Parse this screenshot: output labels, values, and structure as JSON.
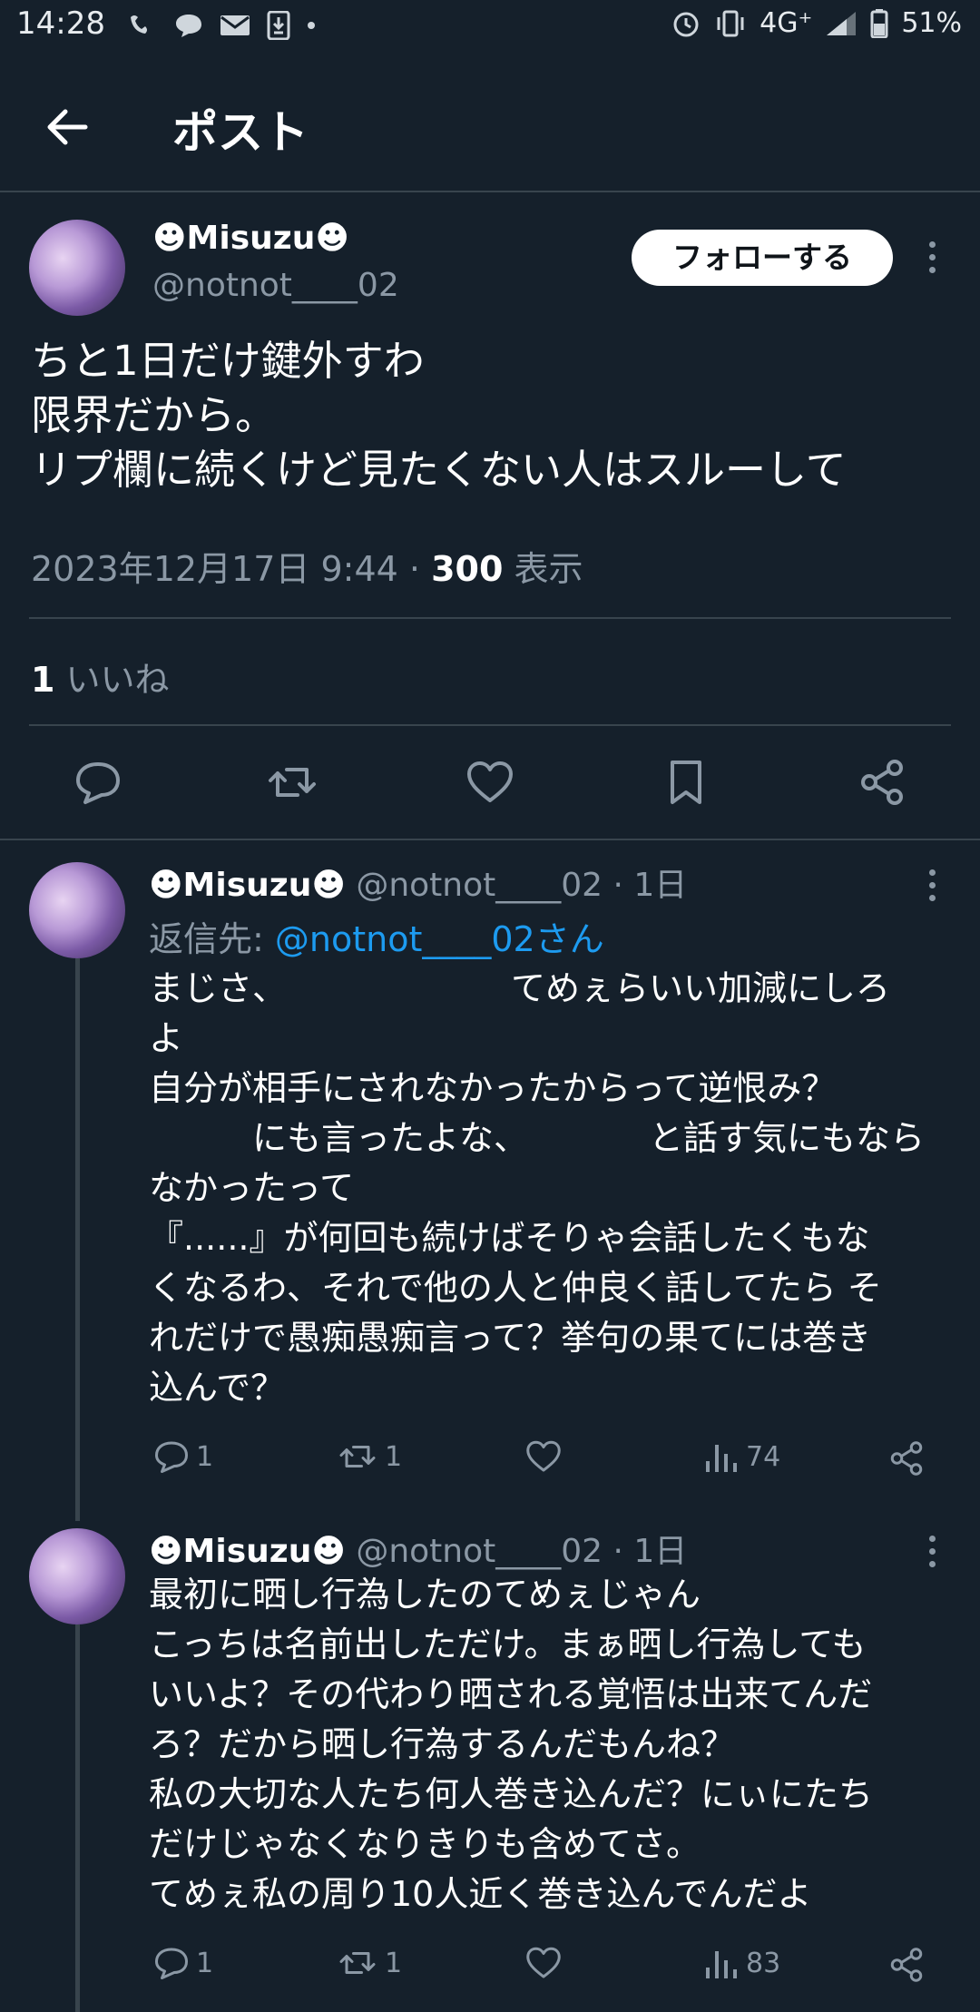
{
  "status_bar": {
    "time": "14:28",
    "network": "4G⁺",
    "battery": "51%"
  },
  "header": {
    "title": "ポスト"
  },
  "main_post": {
    "display_name": "☻Misuzu☻",
    "handle": "@notnot____02",
    "follow_label": "フォローする",
    "lines": [
      "ちと1日だけ鍵外すわ",
      "限界だから。",
      "リプ欄に続くけど見たくない人はスルーして"
    ],
    "timestamp": "2023年12月17日 9:44 · ",
    "views_count": "300",
    "views_label": " 表示",
    "likes_count": "1",
    "likes_label": " いいね"
  },
  "replies": [
    {
      "display_name": "☻Misuzu☻",
      "handle": " @notnot____02 · 1日",
      "reply_to_prefix": "返信先: ",
      "reply_to_handle": "@notnot____02さん",
      "lines": [
        "まじさ、　　　　　　　てめぇらいい加減にしろ",
        "よ",
        "自分が相手にされなかったからって逆恨み？",
        "　　　にも言ったよな、　　　　と話す気にもなら",
        "なかったって",
        "『......』が何回も続けばそりゃ会話したくもな",
        "くなるわ、それで他の人と仲良く話してたら そ",
        "れだけで愚痴愚痴言って？挙句の果てには巻き",
        "込んで？"
      ],
      "reply_count": "1",
      "retweet_count": "1",
      "view_count": "74"
    },
    {
      "display_name": "☻Misuzu☻",
      "handle": " @notnot____02 · 1日",
      "lines": [
        "最初に晒し行為したのてめぇじゃん",
        "こっちは名前出しただけ。まぁ晒し行為しても",
        "いいよ？その代わり晒される覚悟は出来てんだ",
        "ろ？だから晒し行為するんだもんね？",
        "私の大切な人たち何人巻き込んだ？にぃにたち",
        "だけじゃなくなりきりも含めてさ。",
        "てめぇ私の周り10人近く巻き込んでんだよ"
      ],
      "reply_count": "1",
      "retweet_count": "1",
      "view_count": "83"
    }
  ],
  "colors": {
    "background": "#15202b",
    "muted": "#8b98a5",
    "link": "#1d9bf0",
    "divider": "#38444d"
  },
  "icons": [
    "back-arrow-icon",
    "reply-icon",
    "retweet-icon",
    "like-icon",
    "bookmark-icon",
    "share-icon",
    "views-icon",
    "more-icon"
  ]
}
